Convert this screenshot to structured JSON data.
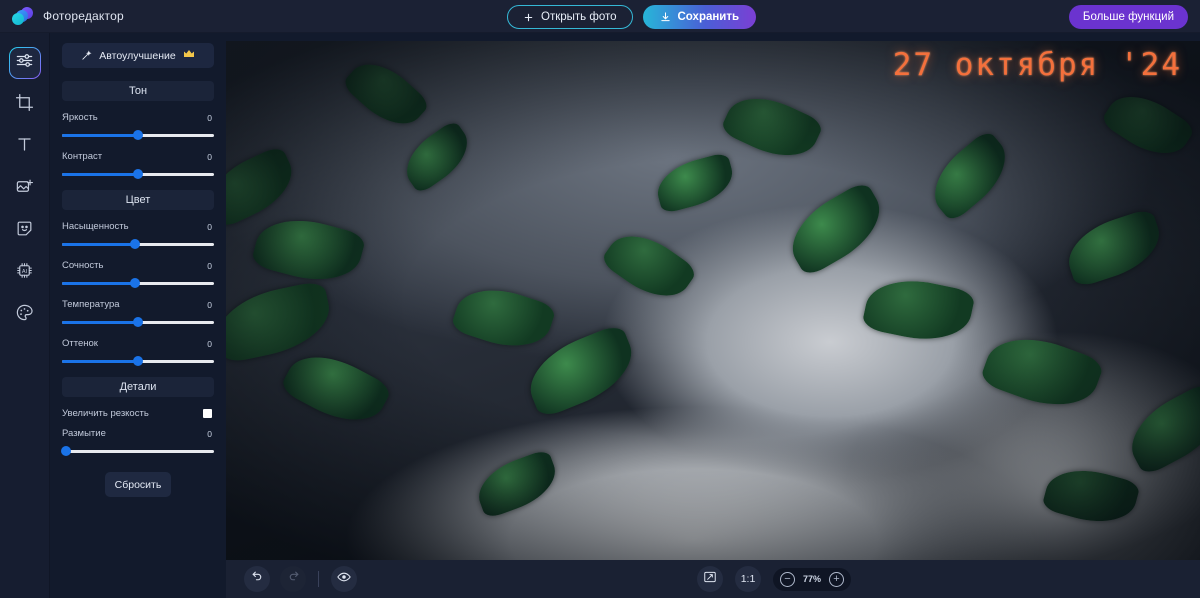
{
  "header": {
    "brand": "Фоторедактор",
    "logo_icon": "logo-circles-icon",
    "open_label": "Открыть фото",
    "open_icon": "plus-icon",
    "save_label": "Сохранить",
    "save_icon": "download-icon",
    "more_label": "Больше функций",
    "accent_cyan": "#27b6d8",
    "accent_purple": "#6b33cf"
  },
  "rail": {
    "items": [
      {
        "name": "adjustments",
        "icon": "sliders-icon",
        "active": true
      },
      {
        "name": "crop",
        "icon": "crop-icon",
        "active": false
      },
      {
        "name": "text",
        "icon": "text-t-icon",
        "active": false
      },
      {
        "name": "add-image",
        "icon": "image-plus-icon",
        "active": false
      },
      {
        "name": "stickers",
        "icon": "sticker-smiley-icon",
        "active": false
      },
      {
        "name": "ai-tools",
        "icon": "ai-chip-icon",
        "active": false
      },
      {
        "name": "effects",
        "icon": "palette-icon",
        "active": false
      }
    ]
  },
  "panel": {
    "auto_enhance": "Автоулучшение",
    "auto_icon": "magic-wand-icon",
    "premium_icon": "crown-icon",
    "sections": [
      {
        "title": "Тон",
        "sliders": [
          {
            "label": "Яркость",
            "value": "0",
            "pos": 50
          },
          {
            "label": "Контраст",
            "value": "0",
            "pos": 50
          }
        ]
      },
      {
        "title": "Цвет",
        "sliders": [
          {
            "label": "Насыщенность",
            "value": "0",
            "pos": 48
          },
          {
            "label": "Сочность",
            "value": "0",
            "pos": 48
          },
          {
            "label": "Температура",
            "value": "0",
            "pos": 50
          },
          {
            "label": "Оттенок",
            "value": "0",
            "pos": 50
          }
        ]
      }
    ],
    "details": {
      "title": "Детали",
      "sharpen_label": "Увеличить резкость",
      "sharpen_checked": false,
      "blur": {
        "label": "Размытие",
        "value": "0",
        "pos": 2
      }
    },
    "reset_label": "Сбросить",
    "slider_fill_color": "#1a73e8"
  },
  "canvas": {
    "date_stamp": "27 октября '24",
    "stamp_color": "#f4703c",
    "photo_description": "statue-with-foliage-photo"
  },
  "bottombar": {
    "undo_icon": "undo-arrow-icon",
    "redo_icon": "redo-arrow-icon",
    "preview_icon": "eye-icon",
    "fit_icon": "fit-screen-icon",
    "ratio_label": "1:1",
    "zoom_out_icon": "minus-circle-icon",
    "zoom_value": "77%",
    "zoom_in_icon": "plus-circle-icon"
  }
}
